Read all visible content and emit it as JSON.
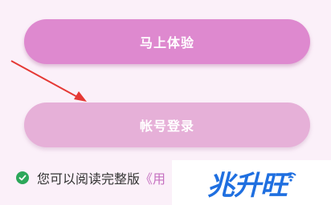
{
  "buttons": {
    "primary_label": "马上体验",
    "secondary_label": "帐号登录"
  },
  "agreement": {
    "text": "您可以阅读完整版",
    "link": "《用"
  },
  "watermark": {
    "text": "兆升旺"
  },
  "colors": {
    "background": "#fbf0f9",
    "primary_button": "#de89cf",
    "secondary_button": "#e6b0d8",
    "annotation_arrow": "#e53935",
    "check": "#2ca75a",
    "watermark": "#1f6fe0"
  },
  "icons": [
    "check-circle-icon",
    "annotation-arrow-icon",
    "wifi-icon"
  ]
}
